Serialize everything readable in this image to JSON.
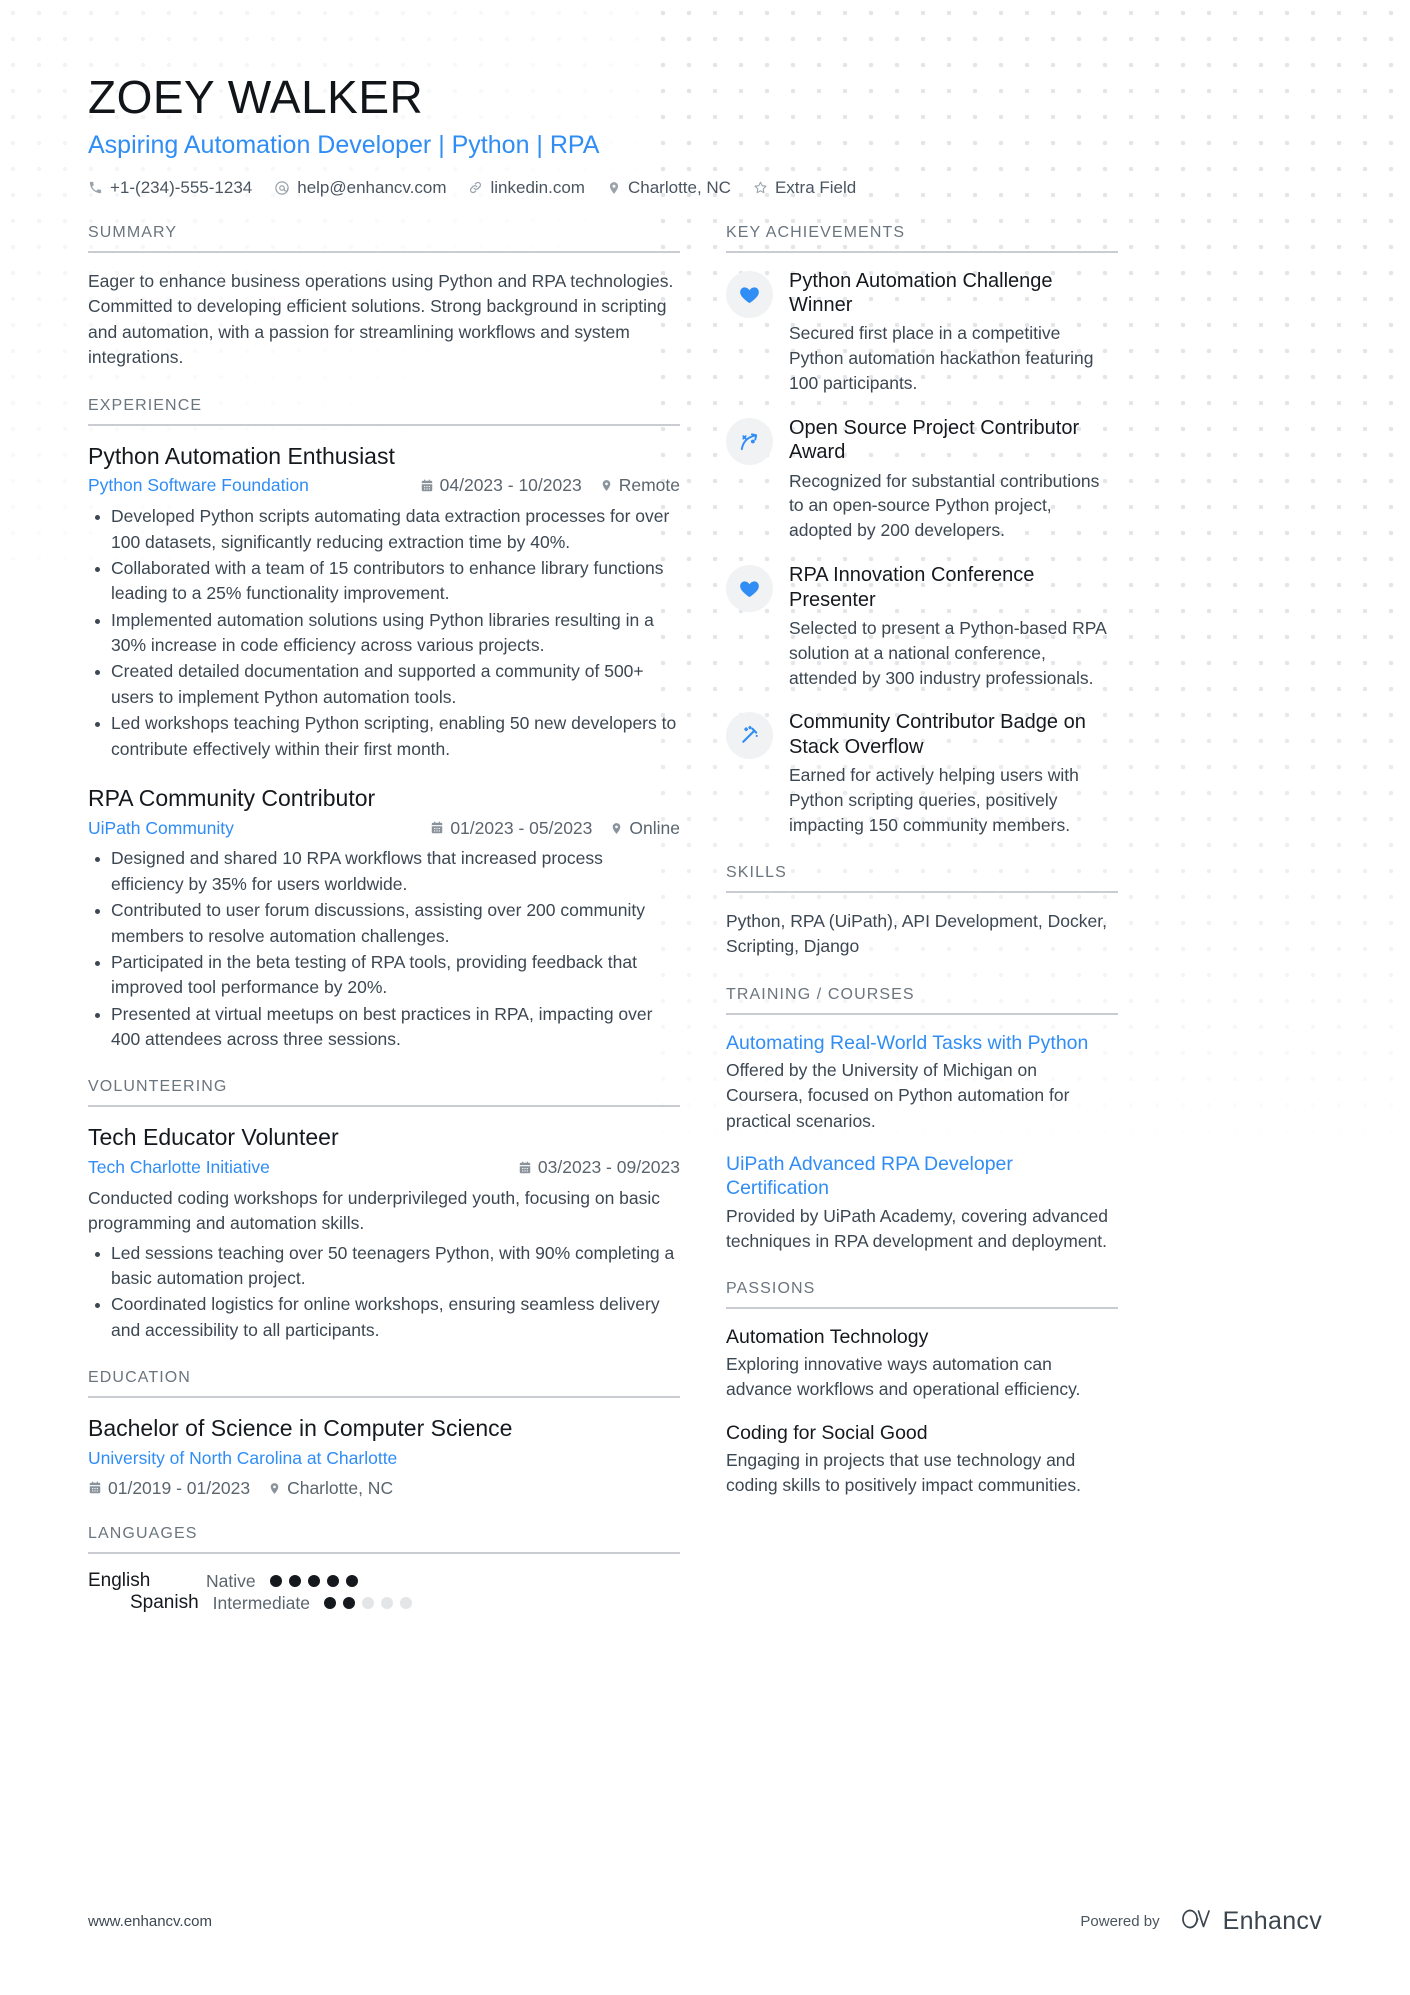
{
  "colors": {
    "accent": "#2f8df5",
    "heading": "#6b757e",
    "text": "#3c4752"
  },
  "header": {
    "name": "ZOEY WALKER",
    "headline": "Aspiring Automation Developer | Python | RPA",
    "contacts": [
      {
        "icon": "phone-icon",
        "text": "+1-(234)-555-1234"
      },
      {
        "icon": "email-icon",
        "text": "help@enhancv.com"
      },
      {
        "icon": "link-icon",
        "text": "linkedin.com"
      },
      {
        "icon": "location-pin-icon",
        "text": "Charlotte, NC"
      },
      {
        "icon": "star-icon",
        "text": "Extra Field"
      }
    ]
  },
  "left": {
    "summary": {
      "title": "SUMMARY",
      "text": "Eager to enhance business operations using Python and RPA technologies. Committed to developing efficient solutions. Strong background in scripting and automation, with a passion for streamlining workflows and system integrations."
    },
    "experience": {
      "title": "EXPERIENCE",
      "entries": [
        {
          "role": "Python Automation Enthusiast",
          "org": "Python Software Foundation",
          "dates": "04/2023 - 10/2023",
          "location": "Remote",
          "bullets": [
            "Developed Python scripts automating data extraction processes for over 100 datasets, significantly reducing extraction time by 40%.",
            "Collaborated with a team of 15 contributors to enhance library functions leading to a 25% functionality improvement.",
            "Implemented automation solutions using Python libraries resulting in a 30% increase in code efficiency across various projects.",
            "Created detailed documentation and supported a community of 500+ users to implement Python automation tools.",
            "Led workshops teaching Python scripting, enabling 50 new developers to contribute effectively within their first month."
          ]
        },
        {
          "role": "RPA Community Contributor",
          "org": "UiPath Community",
          "dates": "01/2023 - 05/2023",
          "location": "Online",
          "bullets": [
            "Designed and shared 10 RPA workflows that increased process efficiency by 35% for users worldwide.",
            "Contributed to user forum discussions, assisting over 200 community members to resolve automation challenges.",
            "Participated in the beta testing of RPA tools, providing feedback that improved tool performance by 20%.",
            "Presented at virtual meetups on best practices in RPA, impacting over 400 attendees across three sessions."
          ]
        }
      ]
    },
    "volunteering": {
      "title": "VOLUNTEERING",
      "entries": [
        {
          "role": "Tech Educator Volunteer",
          "org": "Tech Charlotte Initiative",
          "dates": "03/2023 - 09/2023",
          "location": "",
          "description": "Conducted coding workshops for underprivileged youth, focusing on basic programming and automation skills.",
          "bullets": [
            "Led sessions teaching over 50 teenagers Python, with 90% completing a basic automation project.",
            "Coordinated logistics for online workshops, ensuring seamless delivery and accessibility to all participants."
          ]
        }
      ]
    },
    "education": {
      "title": "EDUCATION",
      "entries": [
        {
          "degree": "Bachelor of Science in Computer Science",
          "school": "University of North Carolina at Charlotte",
          "dates": "01/2019 - 01/2023",
          "location": "Charlotte, NC"
        }
      ]
    },
    "languages": {
      "title": "LANGUAGES",
      "items": [
        {
          "name": "English",
          "level": "Native",
          "filled": 5,
          "total": 5
        },
        {
          "name": "Spanish",
          "level": "Intermediate",
          "filled": 2,
          "total": 5
        }
      ]
    }
  },
  "right": {
    "achievements": {
      "title": "KEY ACHIEVEMENTS",
      "items": [
        {
          "icon": "heart-icon",
          "title": "Python Automation Challenge Winner",
          "description": "Secured first place in a competitive Python automation hackathon featuring 100 participants."
        },
        {
          "icon": "strategy-arrow-icon",
          "title": "Open Source Project Contributor Award",
          "description": "Recognized for substantial contributions to an open-source Python project, adopted by 200 developers."
        },
        {
          "icon": "heart-icon",
          "title": "RPA Innovation Conference Presenter",
          "description": "Selected to present a Python-based RPA solution at a national conference, attended by 300 industry professionals."
        },
        {
          "icon": "magic-wand-icon",
          "title": "Community Contributor Badge on Stack Overflow",
          "description": "Earned for actively helping users with Python scripting queries, positively impacting 150 community members."
        }
      ]
    },
    "skills": {
      "title": "SKILLS",
      "text": "Python, RPA (UiPath), API Development, Docker, Scripting, Django"
    },
    "training": {
      "title": "TRAINING / COURSES",
      "items": [
        {
          "title": "Automating Real-World Tasks with Python",
          "description": "Offered by the University of Michigan on Coursera, focused on Python automation for practical scenarios."
        },
        {
          "title": "UiPath Advanced RPA Developer Certification",
          "description": "Provided by UiPath Academy, covering advanced techniques in RPA development and deployment."
        }
      ]
    },
    "passions": {
      "title": "PASSIONS",
      "items": [
        {
          "title": "Automation Technology",
          "description": "Exploring innovative ways automation can advance workflows and operational efficiency."
        },
        {
          "title": "Coding for Social Good",
          "description": "Engaging in projects that use technology and coding skills to positively impact communities."
        }
      ]
    }
  },
  "footer": {
    "url": "www.enhancv.com",
    "powered_by": "Powered by",
    "brand": "Enhancv"
  }
}
